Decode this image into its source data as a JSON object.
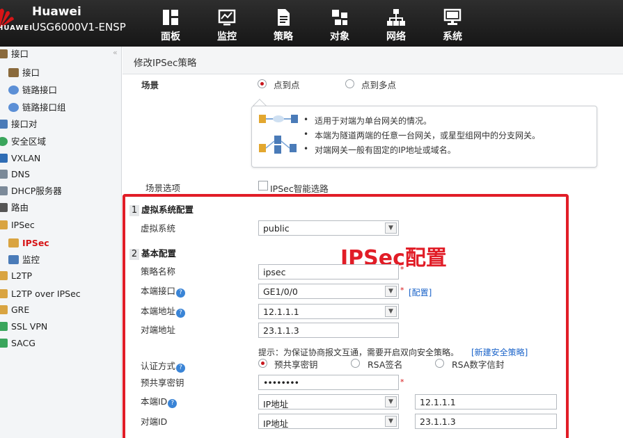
{
  "header": {
    "brand": "Huawei",
    "model": "USG6000V1-ENSP",
    "logo_text": "HUAWEI",
    "nav": [
      {
        "label": "面板",
        "icon": "dashboard-icon"
      },
      {
        "label": "监控",
        "icon": "monitor-icon"
      },
      {
        "label": "策略",
        "icon": "policy-icon"
      },
      {
        "label": "对象",
        "icon": "object-icon"
      },
      {
        "label": "网络",
        "icon": "network-icon",
        "active": true
      },
      {
        "label": "系统",
        "icon": "system-icon"
      }
    ]
  },
  "sidebar": {
    "collapse_glyph": "«",
    "items": [
      {
        "label": "接口",
        "icon": "interface-icon"
      },
      {
        "label": "接口",
        "icon": "interface-icon"
      },
      {
        "label": "链路接口",
        "icon": "link-interface-icon"
      },
      {
        "label": "链路接口组",
        "icon": "link-group-icon"
      },
      {
        "label": "接口对",
        "icon": "interface-pair-icon"
      },
      {
        "label": "安全区域",
        "icon": "security-zone-icon"
      },
      {
        "label": "VXLAN",
        "icon": "vxlan-icon"
      },
      {
        "label": "DNS",
        "icon": "dns-icon"
      },
      {
        "label": "DHCP服务器",
        "icon": "dhcp-icon"
      },
      {
        "label": "路由",
        "icon": "route-icon"
      },
      {
        "label": "IPSec",
        "icon": "ipsec-icon"
      },
      {
        "label": "IPSec",
        "icon": "ipsec-icon",
        "active": true
      },
      {
        "label": "监控",
        "icon": "monitor-icon"
      },
      {
        "label": "L2TP",
        "icon": "l2tp-icon"
      },
      {
        "label": "L2TP over IPSec",
        "icon": "l2tp-ipsec-icon"
      },
      {
        "label": "GRE",
        "icon": "gre-icon"
      },
      {
        "label": "SSL VPN",
        "icon": "ssl-vpn-icon"
      },
      {
        "label": "SACG",
        "icon": "sacg-icon"
      }
    ]
  },
  "main": {
    "title": "修改IPSec策略",
    "scenario": {
      "label": "场景",
      "options": [
        "点到点",
        "点到多点"
      ],
      "selected": "点到点"
    },
    "info_bullets": [
      "适用于对端为单台网关的情况。",
      "本端为隧道两端的任意一台网关，或星型组网中的分支网关。",
      "对端网关一般有固定的IP地址或域名。"
    ],
    "scenario_option": {
      "label": "场景选项",
      "checkbox_label": "IPSec智能选路",
      "checked": false
    },
    "section1": {
      "num": "1",
      "title": "虚拟系统配置"
    },
    "vsys": {
      "label": "虚拟系统",
      "value": "public"
    },
    "section2": {
      "num": "2",
      "title": "基本配置"
    },
    "policy_name": {
      "label": "策略名称",
      "value": "ipsec"
    },
    "local_if": {
      "label": "本端接口",
      "value": "GE1/0/0",
      "link": "[配置]"
    },
    "local_addr": {
      "label": "本端地址",
      "value": "12.1.1.1"
    },
    "peer_addr": {
      "label": "对端地址",
      "value": "23.1.1.3"
    },
    "hint": "提示：为保证协商报文互通，需要开启双向安全策略。",
    "hint_link": "[新建安全策略]",
    "auth": {
      "label": "认证方式",
      "options": [
        "预共享密钥",
        "RSA签名",
        "RSA数字信封"
      ],
      "selected": "预共享密钥"
    },
    "psk": {
      "label": "预共享密钥",
      "value": "••••••••"
    },
    "local_id": {
      "label": "本端ID",
      "type": "IP地址",
      "value": "12.1.1.1"
    },
    "peer_id": {
      "label": "对端ID",
      "type": "IP地址",
      "value": "23.1.1.3"
    },
    "required_mark": "*",
    "help_glyph": "?",
    "arrow_glyph": "▼"
  },
  "annotation": {
    "text": "IPSec配置",
    "color": "#e11d27"
  },
  "colors": {
    "accent": "#d61517",
    "link": "#1a63c9",
    "topbar": "#1e1e1e"
  }
}
